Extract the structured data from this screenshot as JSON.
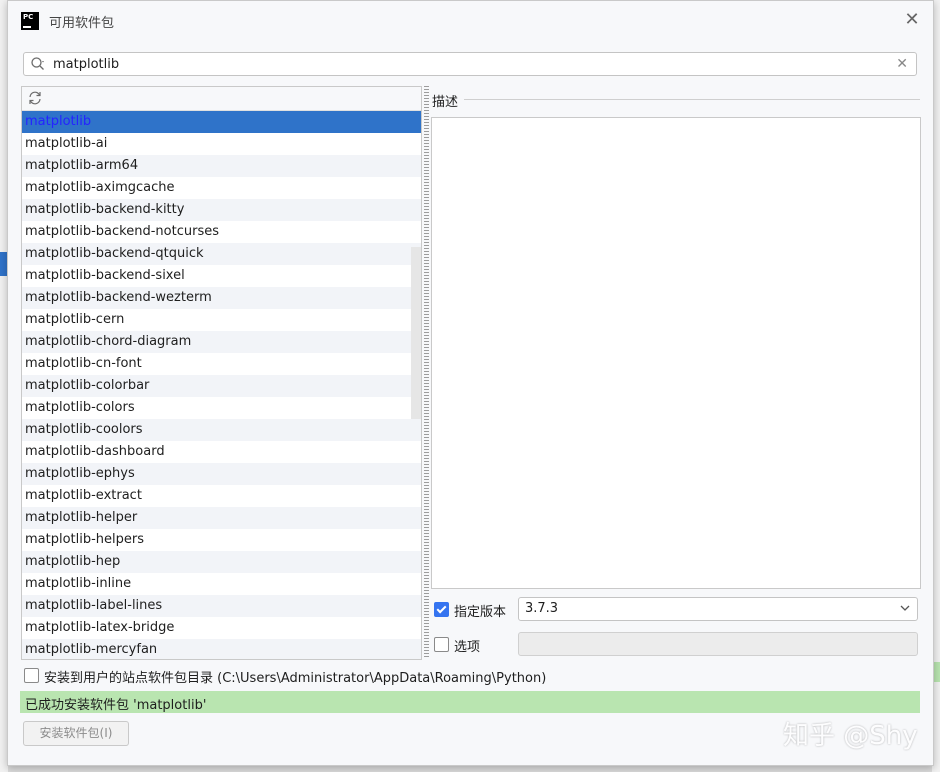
{
  "window": {
    "title": "可用软件包",
    "app_icon_text": "PC"
  },
  "search": {
    "value": "matplotlib"
  },
  "packages": [
    "matplotlib",
    "matplotlib-ai",
    "matplotlib-arm64",
    "matplotlib-aximgcache",
    "matplotlib-backend-kitty",
    "matplotlib-backend-notcurses",
    "matplotlib-backend-qtquick",
    "matplotlib-backend-sixel",
    "matplotlib-backend-wezterm",
    "matplotlib-cern",
    "matplotlib-chord-diagram",
    "matplotlib-cn-font",
    "matplotlib-colorbar",
    "matplotlib-colors",
    "matplotlib-coolors",
    "matplotlib-dashboard",
    "matplotlib-ephys",
    "matplotlib-extract",
    "matplotlib-helper",
    "matplotlib-helpers",
    "matplotlib-hep",
    "matplotlib-inline",
    "matplotlib-label-lines",
    "matplotlib-latex-bridge",
    "matplotlib-mercyfan"
  ],
  "selected_index": 0,
  "description": {
    "label": "描述"
  },
  "version": {
    "checkbox_label": "指定版本",
    "checked": true,
    "value": "3.7.3"
  },
  "options": {
    "checkbox_label": "选项",
    "checked": false,
    "value": ""
  },
  "user_site": {
    "label": "安装到用户的站点软件包目录 (C:\\Users\\Administrator\\AppData\\Roaming\\Python)",
    "checked": false
  },
  "status": {
    "message": "已成功安装软件包 'matplotlib'"
  },
  "install_button": {
    "label": "安装软件包(I)"
  },
  "watermark": "知乎 @Shy",
  "colors": {
    "selection": "#2f73c9",
    "selection_text": "#2424ff",
    "success_bg": "#b9e5b0",
    "checkbox_on": "#3574f0"
  },
  "icons": {
    "refresh": "refresh-icon",
    "search": "search-icon",
    "close": "close-icon",
    "clear": "clear-search-icon",
    "chevron": "chevron-down-icon"
  }
}
